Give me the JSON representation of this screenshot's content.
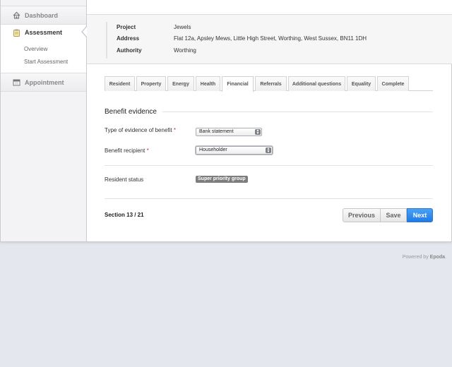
{
  "sidebar": {
    "items": [
      {
        "label": "Dashboard",
        "icon": "home-icon"
      },
      {
        "label": "Assessment",
        "icon": "clipboard-icon",
        "active": true,
        "children": [
          "Overview",
          "Start Assessment"
        ]
      },
      {
        "label": "Appointment",
        "icon": "calendar-icon"
      }
    ]
  },
  "info": {
    "project_label": "Project",
    "project_value": "Jewels",
    "address_label": "Address",
    "address_value": "Flat 12a, Apsley Mews, Little High Street, Worthing, West Sussex, BN11 1DH",
    "authority_label": "Authority",
    "authority_value": "Worthing"
  },
  "tabs": [
    "Resident",
    "Property",
    "Energy",
    "Health",
    "Financial",
    "Referrals",
    "Additional questions",
    "Equality",
    "Complete"
  ],
  "active_tab": "Financial",
  "form": {
    "section_title": "Benefit evidence",
    "evidence_label": "Type of evidence of benefit",
    "evidence_value": "Bank statement",
    "recipient_label": "Benefit recipient",
    "recipient_value": "Householder",
    "required_marker": "*",
    "status_label": "Resident status",
    "status_badge": "Super priority group"
  },
  "pager": {
    "section": "Section 13 / 21",
    "previous": "Previous",
    "save": "Save",
    "next": "Next"
  },
  "footer": {
    "prefix": "Powered by",
    "brand": "Epoda",
    "suffix": "."
  },
  "colors": {
    "accent": "#1f7ae6",
    "badge": "#7d7d7d",
    "required": "#c0392b"
  }
}
